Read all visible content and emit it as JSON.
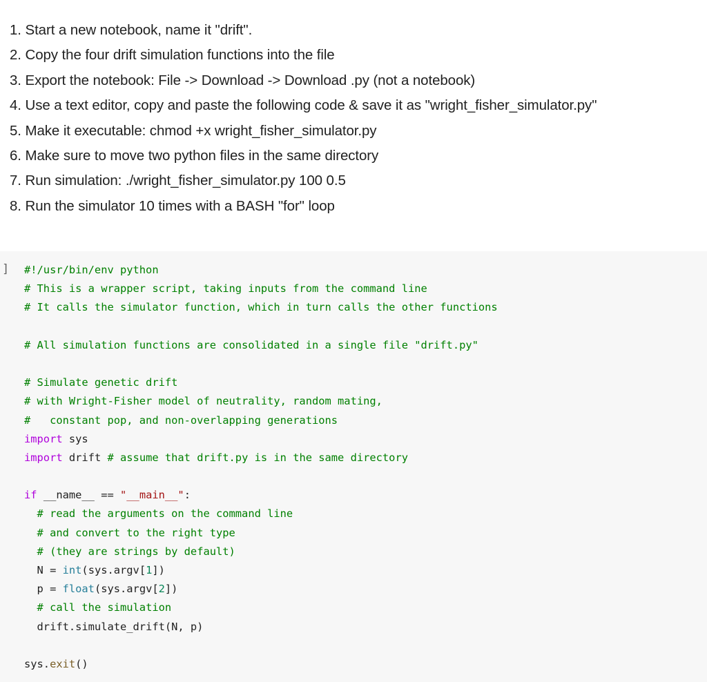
{
  "instructions": [
    "1. Start a new notebook, name it \"drift\".",
    "2. Copy the four drift simulation functions into the file",
    "3. Export the notebook: File -> Download -> Download .py (not a notebook)",
    "4. Use a text editor, copy and paste the following code & save it as \"wright_fisher_simulator.py\"",
    "5. Make it executable: chmod +x wright_fisher_simulator.py",
    "6. Make sure to move two python files in the same directory",
    "7. Run simulation: ./wright_fisher_simulator.py 100 0.5",
    "8. Run the simulator 10 times with a BASH \"for\" loop"
  ],
  "code_cell": {
    "bracket": "]",
    "colors": {
      "background": "#f7f7f7",
      "comment": "#008000",
      "keyword": "#af00db",
      "string": "#a31515",
      "builtin": "#267f99",
      "number": "#098658",
      "function": "#795e26",
      "text": "#212121"
    },
    "lines": [
      [
        {
          "t": "com",
          "v": "#!/usr/bin/env python"
        }
      ],
      [
        {
          "t": "com",
          "v": "# This is a wrapper script, taking inputs from the command line"
        }
      ],
      [
        {
          "t": "com",
          "v": "# It calls the simulator function, which in turn calls the other functions"
        }
      ],
      [],
      [
        {
          "t": "com",
          "v": "# All simulation functions are consolidated in a single file \"drift.py\""
        }
      ],
      [],
      [
        {
          "t": "com",
          "v": "# Simulate genetic drift"
        }
      ],
      [
        {
          "t": "com",
          "v": "# with Wright-Fisher model of neutrality, random mating,"
        }
      ],
      [
        {
          "t": "com",
          "v": "#   constant pop, and non-overlapping generations"
        }
      ],
      [
        {
          "t": "kw",
          "v": "import"
        },
        {
          "t": "plain",
          "v": " sys"
        }
      ],
      [
        {
          "t": "kw",
          "v": "import"
        },
        {
          "t": "plain",
          "v": " drift "
        },
        {
          "t": "com",
          "v": "# assume that drift.py is in the same directory"
        }
      ],
      [],
      [
        {
          "t": "kw",
          "v": "if"
        },
        {
          "t": "plain",
          "v": " __name__ == "
        },
        {
          "t": "str",
          "v": "\"__main__\""
        },
        {
          "t": "plain",
          "v": ":"
        }
      ],
      [
        {
          "t": "plain",
          "v": "  "
        },
        {
          "t": "com",
          "v": "# read the arguments on the command line"
        }
      ],
      [
        {
          "t": "plain",
          "v": "  "
        },
        {
          "t": "com",
          "v": "# and convert to the right type"
        }
      ],
      [
        {
          "t": "plain",
          "v": "  "
        },
        {
          "t": "com",
          "v": "# (they are strings by default)"
        }
      ],
      [
        {
          "t": "plain",
          "v": "  N = "
        },
        {
          "t": "builtin",
          "v": "int"
        },
        {
          "t": "plain",
          "v": "(sys.argv["
        },
        {
          "t": "num",
          "v": "1"
        },
        {
          "t": "plain",
          "v": "])"
        }
      ],
      [
        {
          "t": "plain",
          "v": "  p = "
        },
        {
          "t": "builtin",
          "v": "float"
        },
        {
          "t": "plain",
          "v": "(sys.argv["
        },
        {
          "t": "num",
          "v": "2"
        },
        {
          "t": "plain",
          "v": "])"
        }
      ],
      [
        {
          "t": "plain",
          "v": "  "
        },
        {
          "t": "com",
          "v": "# call the simulation"
        }
      ],
      [
        {
          "t": "plain",
          "v": "  drift.simulate_drift(N, p)"
        }
      ],
      [],
      [
        {
          "t": "plain",
          "v": "sys."
        },
        {
          "t": "fn",
          "v": "exit"
        },
        {
          "t": "plain",
          "v": "()"
        }
      ]
    ]
  }
}
